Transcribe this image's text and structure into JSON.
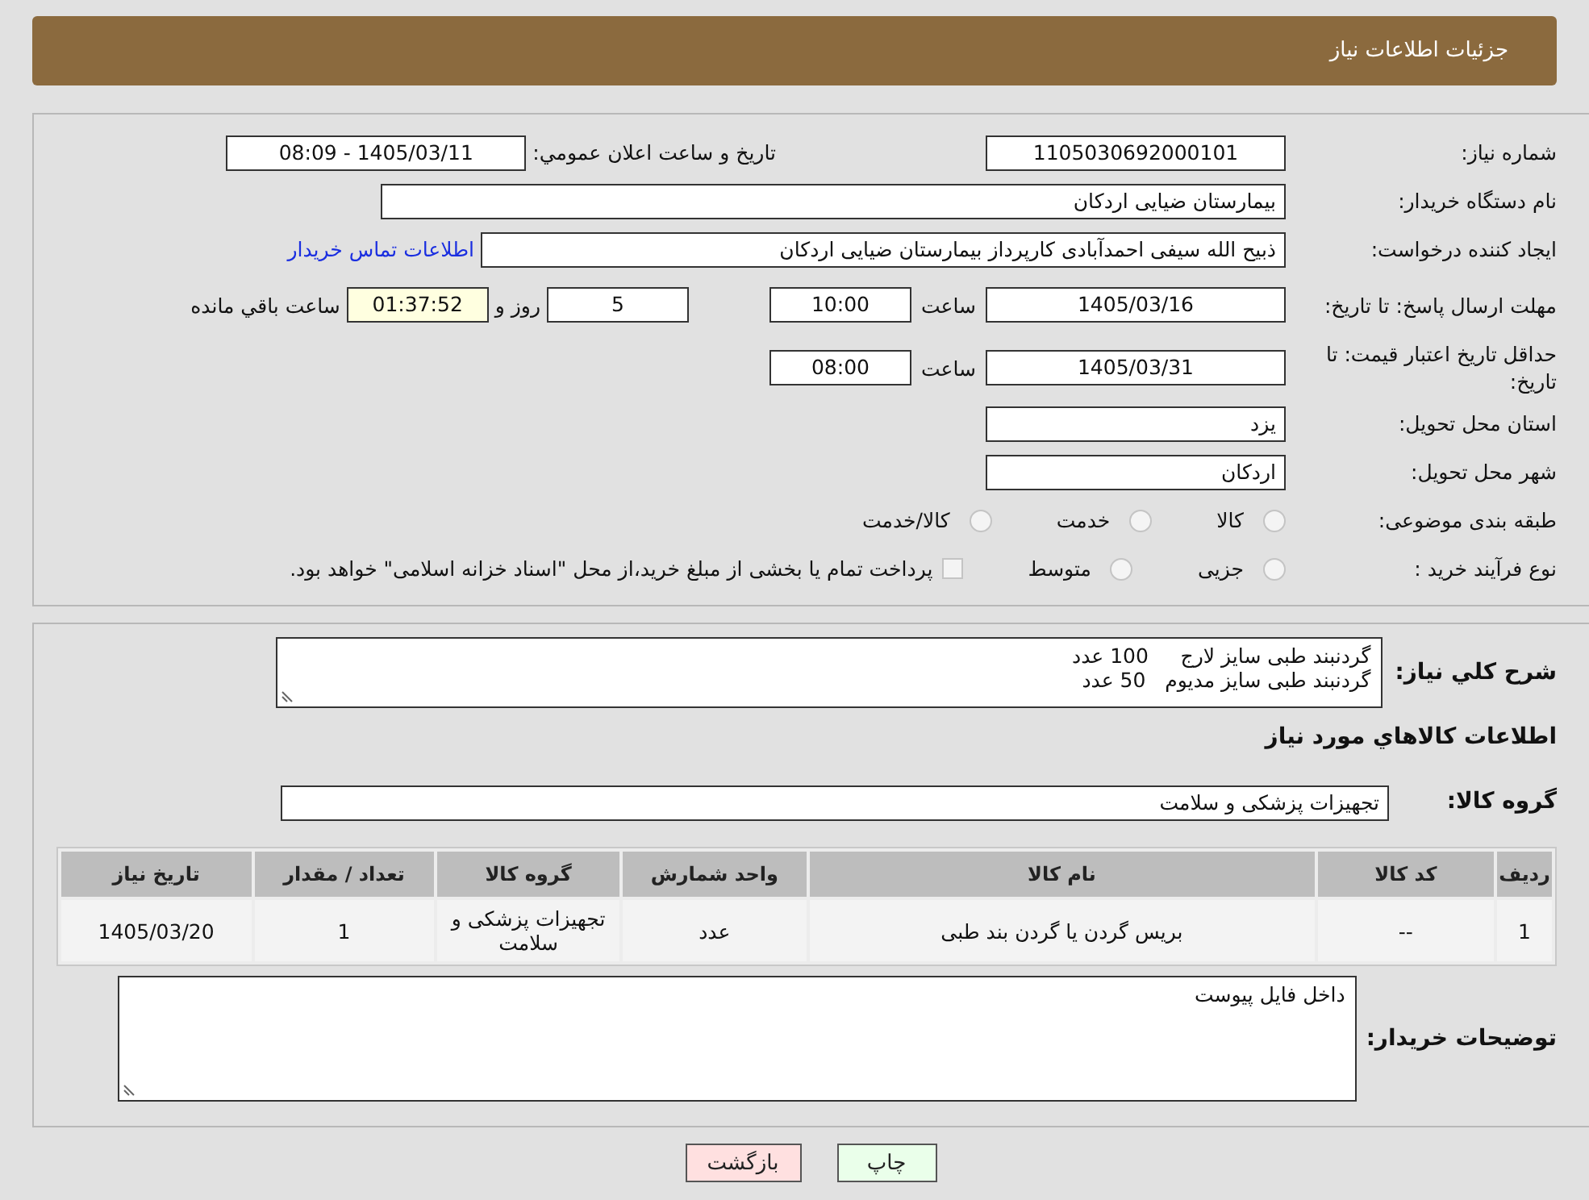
{
  "header": {
    "title": "جزئیات اطلاعات نیاز"
  },
  "need_number": {
    "label": "شماره نیاز:",
    "value": "1105030692000101"
  },
  "announce": {
    "label": "تاریخ و ساعت اعلان عمومي:",
    "value": "1405/03/11 - 08:09"
  },
  "buyer": {
    "label": "نام دستگاه خریدار:",
    "value": "بیمارستان ضیایی اردکان"
  },
  "creator": {
    "label": "ایجاد کننده درخواست:",
    "value": "ذبیح الله سیفی احمدآبادی کارپرداز بیمارستان ضیایی اردکان",
    "link": "اطلاعات تماس خریدار"
  },
  "reply_deadline": {
    "label": "مهلت ارسال پاسخ: تا تاریخ:",
    "date": "1405/03/16",
    "time_label": "ساعت",
    "time": "10:00",
    "days": "5",
    "days_label": "روز و",
    "remaining": "01:37:52",
    "remaining_label": "ساعت باقي مانده"
  },
  "price_deadline": {
    "label": "حداقل تاریخ اعتبار قیمت: تا تاریخ:",
    "date": "1405/03/31",
    "time_label": "ساعت",
    "time": "08:00"
  },
  "province": {
    "label": "استان محل تحویل:",
    "value": "یزد"
  },
  "city": {
    "label": "شهر محل تحویل:",
    "value": "اردکان"
  },
  "category": {
    "label": "طبقه بندی موضوعی:",
    "options": [
      {
        "label": "کالا",
        "selected": false
      },
      {
        "label": "خدمت",
        "selected": false
      },
      {
        "label": "کالا/خدمت",
        "selected": false
      }
    ]
  },
  "process": {
    "label": "نوع فرآیند خرید :",
    "options": [
      {
        "label": "جزیی",
        "selected": false
      },
      {
        "label": "متوسط",
        "selected": false
      }
    ],
    "payment": {
      "checked": false,
      "text": "پرداخت تمام یا بخشی از مبلغ خرید،از محل \"اسناد خزانه اسلامی\" خواهد بود."
    }
  },
  "description": {
    "label": "شرح کلي نياز:",
    "lines": [
      "گردنبند طبی سایز لارج     100 عدد",
      "گردنبند طبی سایز مدیوم   50 عدد"
    ]
  },
  "goods_heading": "اطلاعات کالاهاي مورد نياز",
  "goods_group": {
    "label": "گروه کالا:",
    "value": "تجهیزات پزشکی و سلامت"
  },
  "table": {
    "columns": [
      "ردیف",
      "کد کالا",
      "نام کالا",
      "واحد شمارش",
      "گروه کالا",
      "تعداد / مقدار",
      "تاریخ نیاز"
    ],
    "rows": [
      [
        "1",
        "--",
        "بریس گردن یا گردن بند طبی",
        "عدد",
        "تجهیزات پزشکی و سلامت",
        "1",
        "1405/03/20"
      ]
    ]
  },
  "notes": {
    "label": "توضیحات خریدار:",
    "value": "داخل فایل پیوست"
  },
  "buttons": [
    {
      "label": "چاپ",
      "kind": "print"
    },
    {
      "label": "بازگشت",
      "kind": "back"
    }
  ]
}
